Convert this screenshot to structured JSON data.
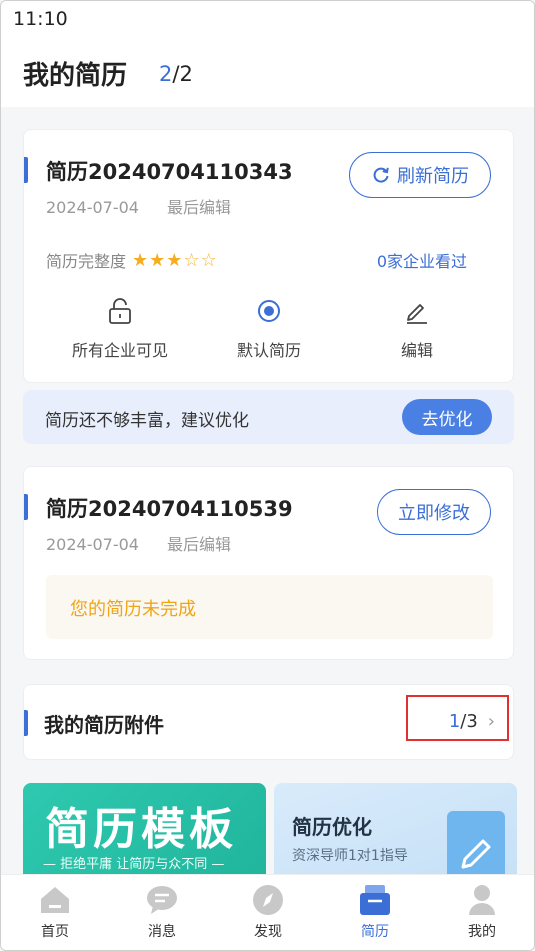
{
  "status": {
    "time": "11:10"
  },
  "header": {
    "title": "我的简历",
    "current": "2",
    "total_sep": "/2"
  },
  "resumes": [
    {
      "name": "简历20240704110343",
      "date": "2024-07-04",
      "edited_label": "最后编辑",
      "action_button": "刷新简历",
      "completeness_label": "简历完整度",
      "completeness_stars": 3,
      "stars_total": 5,
      "viewed": "0家企业看过",
      "actions": {
        "visible": "所有企业可见",
        "default": "默认简历",
        "edit": "编辑"
      }
    },
    {
      "name": "简历20240704110539",
      "date": "2024-07-04",
      "edited_label": "最后编辑",
      "action_button": "立即修改",
      "incomplete_text": "您的简历未完成"
    }
  ],
  "tip": {
    "text": "简历还不够丰富，建议优化",
    "button": "去优化"
  },
  "attachments": {
    "title": "我的简历附件",
    "current": "1",
    "total_sep": "/3"
  },
  "banners": {
    "template": {
      "title": "简历模板",
      "subtitle": "— 拒绝平庸 让简历与众不同 —"
    },
    "optimize": {
      "title": "简历优化",
      "subtitle": "资深导师1对1指导"
    }
  },
  "tabs": [
    {
      "label": "首页",
      "icon": "home-icon"
    },
    {
      "label": "消息",
      "icon": "chat-icon"
    },
    {
      "label": "发现",
      "icon": "compass-icon"
    },
    {
      "label": "简历",
      "icon": "resume-icon",
      "active": true
    },
    {
      "label": "我的",
      "icon": "person-icon"
    }
  ],
  "colors": {
    "accent": "#3b6fd6",
    "star": "#f6ad1f",
    "warning": "#f0a417",
    "highlight_box": "#e03030"
  }
}
